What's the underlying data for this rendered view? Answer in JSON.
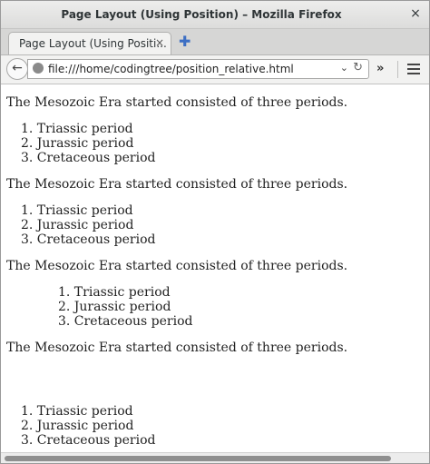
{
  "window": {
    "title": "Page Layout (Using Position) – Mozilla Firefox",
    "close_symbol": "×"
  },
  "tab": {
    "label": "Page Layout (Using Positi...",
    "close_symbol": "×",
    "new_tab_symbol": "✚"
  },
  "navbar": {
    "back_symbol": "←",
    "url": "file:///home/codingtree/position_relative.html",
    "dropdown_symbol": "⌄",
    "reload_symbol": "↻",
    "overflow_symbol": "»"
  },
  "sections": [
    {
      "paragraph": "The Mesozoic Era started consisted of three periods.",
      "items": [
        "1. Triassic period",
        "2. Jurassic period",
        "3. Cretaceous period"
      ]
    },
    {
      "paragraph": "The Mesozoic Era started consisted of three periods.",
      "items": [
        "1. Triassic period",
        "2. Jurassic period",
        "3. Cretaceous period"
      ]
    },
    {
      "paragraph": "The Mesozoic Era started consisted of three periods.",
      "items": [
        "1. Triassic period",
        "2. Jurassic period",
        "3. Cretaceous period"
      ]
    },
    {
      "paragraph": "The Mesozoic Era started consisted of three periods.",
      "items": [
        "1. Triassic period",
        "2. Jurassic period",
        "3. Cretaceous period"
      ]
    }
  ]
}
